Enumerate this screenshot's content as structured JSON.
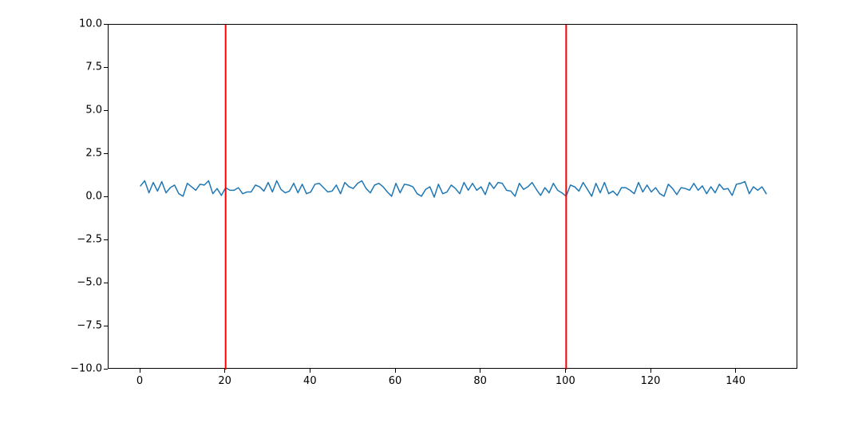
{
  "chart_data": {
    "type": "line",
    "title": "",
    "xlabel": "",
    "ylabel": "",
    "xlim": [
      -7.5,
      154.5
    ],
    "ylim": [
      -10.0,
      10.0
    ],
    "xticks": [
      0,
      20,
      40,
      60,
      80,
      100,
      120,
      140
    ],
    "yticks": [
      -10.0,
      -7.5,
      -5.0,
      -2.5,
      0.0,
      2.5,
      5.0,
      7.5,
      10.0
    ],
    "xtick_labels": [
      "0",
      "20",
      "40",
      "60",
      "80",
      "100",
      "120",
      "140"
    ],
    "ytick_labels": [
      "−10.0",
      "−7.5",
      "−5.0",
      "−2.5",
      "0.0",
      "2.5",
      "5.0",
      "7.5",
      "10.0"
    ],
    "vlines": [
      {
        "x": 20,
        "color": "#ff0000"
      },
      {
        "x": 100,
        "color": "#ff0000"
      }
    ],
    "series": [
      {
        "name": "series-0",
        "color": "#1f77b4",
        "x": [
          0,
          1,
          2,
          3,
          4,
          5,
          6,
          7,
          8,
          9,
          10,
          11,
          12,
          13,
          14,
          15,
          16,
          17,
          18,
          19,
          20,
          21,
          22,
          23,
          24,
          25,
          26,
          27,
          28,
          29,
          30,
          31,
          32,
          33,
          34,
          35,
          36,
          37,
          38,
          39,
          40,
          41,
          42,
          43,
          44,
          45,
          46,
          47,
          48,
          49,
          50,
          51,
          52,
          53,
          54,
          55,
          56,
          57,
          58,
          59,
          60,
          61,
          62,
          63,
          64,
          65,
          66,
          67,
          68,
          69,
          70,
          71,
          72,
          73,
          74,
          75,
          76,
          77,
          78,
          79,
          80,
          81,
          82,
          83,
          84,
          85,
          86,
          87,
          88,
          89,
          90,
          91,
          92,
          93,
          94,
          95,
          96,
          97,
          98,
          99,
          100,
          101,
          102,
          103,
          104,
          105,
          106,
          107,
          108,
          109,
          110,
          111,
          112,
          113,
          114,
          115,
          116,
          117,
          118,
          119,
          120,
          121,
          122,
          123,
          124,
          125,
          126,
          127,
          128,
          129,
          130,
          131,
          132,
          133,
          134,
          135,
          136,
          137,
          138,
          139,
          140,
          141,
          142,
          143,
          144,
          145,
          146,
          147
        ],
        "values": [
          0.65,
          0.95,
          0.25,
          0.85,
          0.35,
          0.9,
          0.25,
          0.55,
          0.7,
          0.2,
          0.05,
          0.8,
          0.6,
          0.4,
          0.75,
          0.7,
          0.95,
          0.2,
          0.5,
          0.1,
          0.55,
          0.4,
          0.4,
          0.55,
          0.2,
          0.3,
          0.3,
          0.7,
          0.6,
          0.35,
          0.85,
          0.3,
          0.95,
          0.45,
          0.25,
          0.35,
          0.8,
          0.25,
          0.75,
          0.2,
          0.3,
          0.75,
          0.8,
          0.55,
          0.3,
          0.35,
          0.7,
          0.2,
          0.85,
          0.6,
          0.5,
          0.8,
          0.95,
          0.5,
          0.25,
          0.7,
          0.8,
          0.6,
          0.3,
          0.05,
          0.8,
          0.25,
          0.75,
          0.7,
          0.6,
          0.2,
          0.05,
          0.45,
          0.6,
          0.0,
          0.75,
          0.2,
          0.3,
          0.7,
          0.5,
          0.2,
          0.85,
          0.4,
          0.8,
          0.4,
          0.6,
          0.15,
          0.85,
          0.5,
          0.85,
          0.8,
          0.4,
          0.35,
          0.05,
          0.8,
          0.45,
          0.6,
          0.85,
          0.45,
          0.1,
          0.55,
          0.25,
          0.8,
          0.4,
          0.25,
          0.05,
          0.7,
          0.6,
          0.35,
          0.85,
          0.45,
          0.05,
          0.8,
          0.25,
          0.85,
          0.2,
          0.35,
          0.1,
          0.55,
          0.55,
          0.4,
          0.2,
          0.85,
          0.3,
          0.7,
          0.3,
          0.55,
          0.2,
          0.05,
          0.75,
          0.5,
          0.15,
          0.55,
          0.5,
          0.4,
          0.8,
          0.4,
          0.65,
          0.2,
          0.6,
          0.25,
          0.75,
          0.45,
          0.5,
          0.1,
          0.75,
          0.8,
          0.9,
          0.2,
          0.6,
          0.4,
          0.6,
          0.2
        ]
      }
    ]
  }
}
